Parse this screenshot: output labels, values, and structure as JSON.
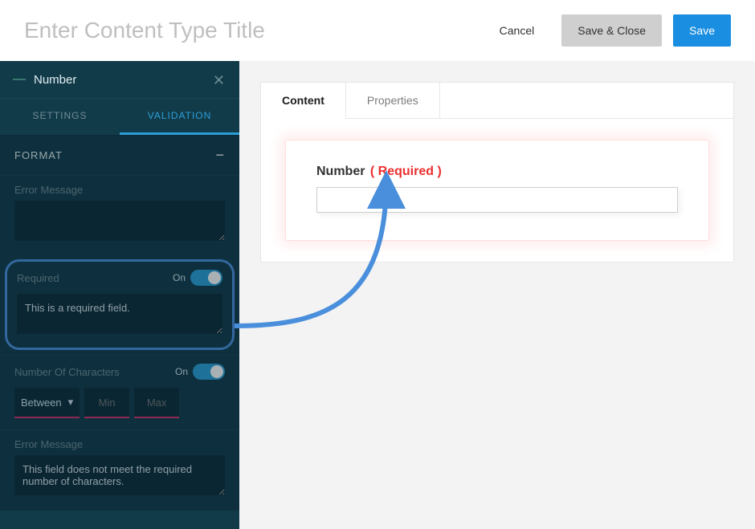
{
  "header": {
    "title": "Enter Content Type Title",
    "cancel": "Cancel",
    "saveClose": "Save & Close",
    "save": "Save"
  },
  "sidebar": {
    "itemType": "Number",
    "tabs": {
      "settings": "SETTINGS",
      "validation": "VALIDATION"
    },
    "formatLabel": "FORMAT",
    "errorMessage1": {
      "label": "Error Message",
      "value": ""
    },
    "required": {
      "label": "Required",
      "switch": "On",
      "message": "This is a required field."
    },
    "numChars": {
      "label": "Number Of Characters",
      "switch": "On",
      "mode": "Between",
      "minPh": "Min",
      "maxPh": "Max"
    },
    "errorMessage2": {
      "label": "Error Message",
      "value": "This field does not meet the required number of characters."
    }
  },
  "content": {
    "tabs": {
      "content": "Content",
      "properties": "Properties"
    },
    "fieldLabel": "Number",
    "requiredTag": "( Required )"
  }
}
